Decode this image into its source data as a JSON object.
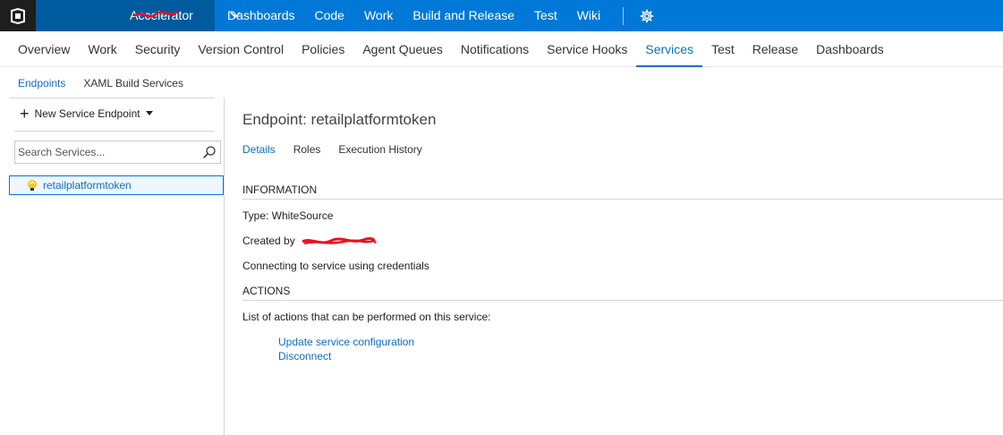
{
  "topbar": {
    "project_name": "Accelerator",
    "nav": [
      "Dashboards",
      "Code",
      "Work",
      "Build and Release",
      "Test",
      "Wiki"
    ],
    "colors": {
      "bar": "#0078d7",
      "project_bg": "#005a9e",
      "logo_bg": "#1e1e1e"
    }
  },
  "subnav": {
    "items": [
      "Overview",
      "Work",
      "Security",
      "Version Control",
      "Policies",
      "Agent Queues",
      "Notifications",
      "Service Hooks",
      "Services",
      "Test",
      "Release",
      "Dashboards"
    ],
    "active": "Services"
  },
  "thirdnav": {
    "items": [
      "Endpoints",
      "XAML Build Services"
    ],
    "active": "Endpoints"
  },
  "left": {
    "new_endpoint_label": "New Service Endpoint",
    "search_placeholder": "Search Services...",
    "endpoints": [
      "retailplatformtoken"
    ]
  },
  "main": {
    "title": "Endpoint: retailplatformtoken",
    "tabs": [
      "Details",
      "Roles",
      "Execution History"
    ],
    "active_tab": "Details",
    "information_heading": "INFORMATION",
    "type_line": "Type: WhiteSource",
    "created_by_label": "Created by",
    "connecting_line": "Connecting to service using credentials",
    "actions_heading": "ACTIONS",
    "actions_intro": "List of actions that can be performed on this service:",
    "actions": [
      "Update service configuration",
      "Disconnect"
    ]
  },
  "accent_color": "#106ebe"
}
